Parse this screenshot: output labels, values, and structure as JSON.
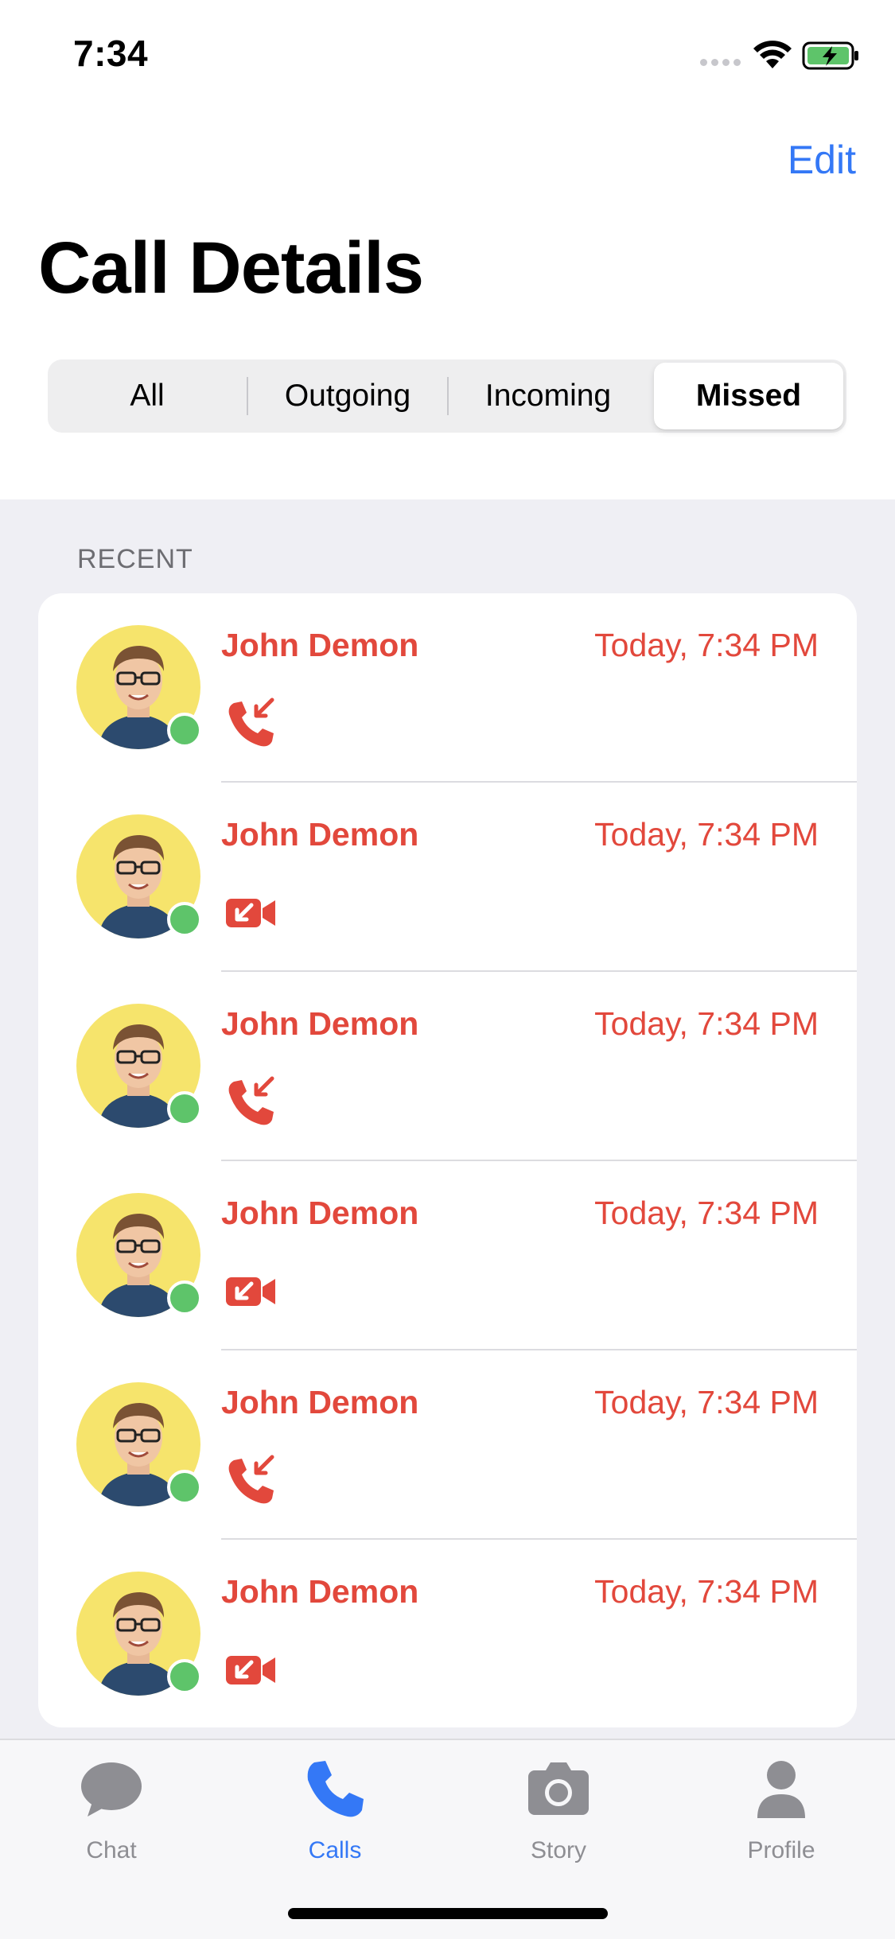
{
  "status_bar": {
    "time": "7:34"
  },
  "header": {
    "edit_label": "Edit",
    "title": "Call Details"
  },
  "segments": {
    "all": "All",
    "outgoing": "Outgoing",
    "incoming": "Incoming",
    "missed": "Missed",
    "selected": "Missed"
  },
  "list": {
    "section_title": "RECENT",
    "items": [
      {
        "name": "John Demon",
        "time": "Today, 7:34 PM",
        "call_type": "audio",
        "icon": "missed-call-icon"
      },
      {
        "name": "John Demon",
        "time": "Today, 7:34 PM",
        "call_type": "video",
        "icon": "missed-video-call-icon"
      },
      {
        "name": "John Demon",
        "time": "Today, 7:34 PM",
        "call_type": "audio",
        "icon": "missed-call-icon"
      },
      {
        "name": "John Demon",
        "time": "Today, 7:34 PM",
        "call_type": "video",
        "icon": "missed-video-call-icon"
      },
      {
        "name": "John Demon",
        "time": "Today, 7:34 PM",
        "call_type": "audio",
        "icon": "missed-call-icon"
      },
      {
        "name": "John Demon",
        "time": "Today, 7:34 PM",
        "call_type": "video",
        "icon": "missed-video-call-icon"
      }
    ]
  },
  "tab_bar": {
    "tabs": [
      {
        "label": "Chat",
        "icon": "chat-bubble-icon"
      },
      {
        "label": "Calls",
        "icon": "phone-icon",
        "active": true
      },
      {
        "label": "Story",
        "icon": "camera-icon"
      },
      {
        "label": "Profile",
        "icon": "person-icon"
      }
    ]
  },
  "colors": {
    "accent": "#3478f6",
    "missed": "#e2483c",
    "online": "#5ec46a",
    "avatar_bg": "#f6e46c",
    "list_bg": "#efeff4"
  }
}
